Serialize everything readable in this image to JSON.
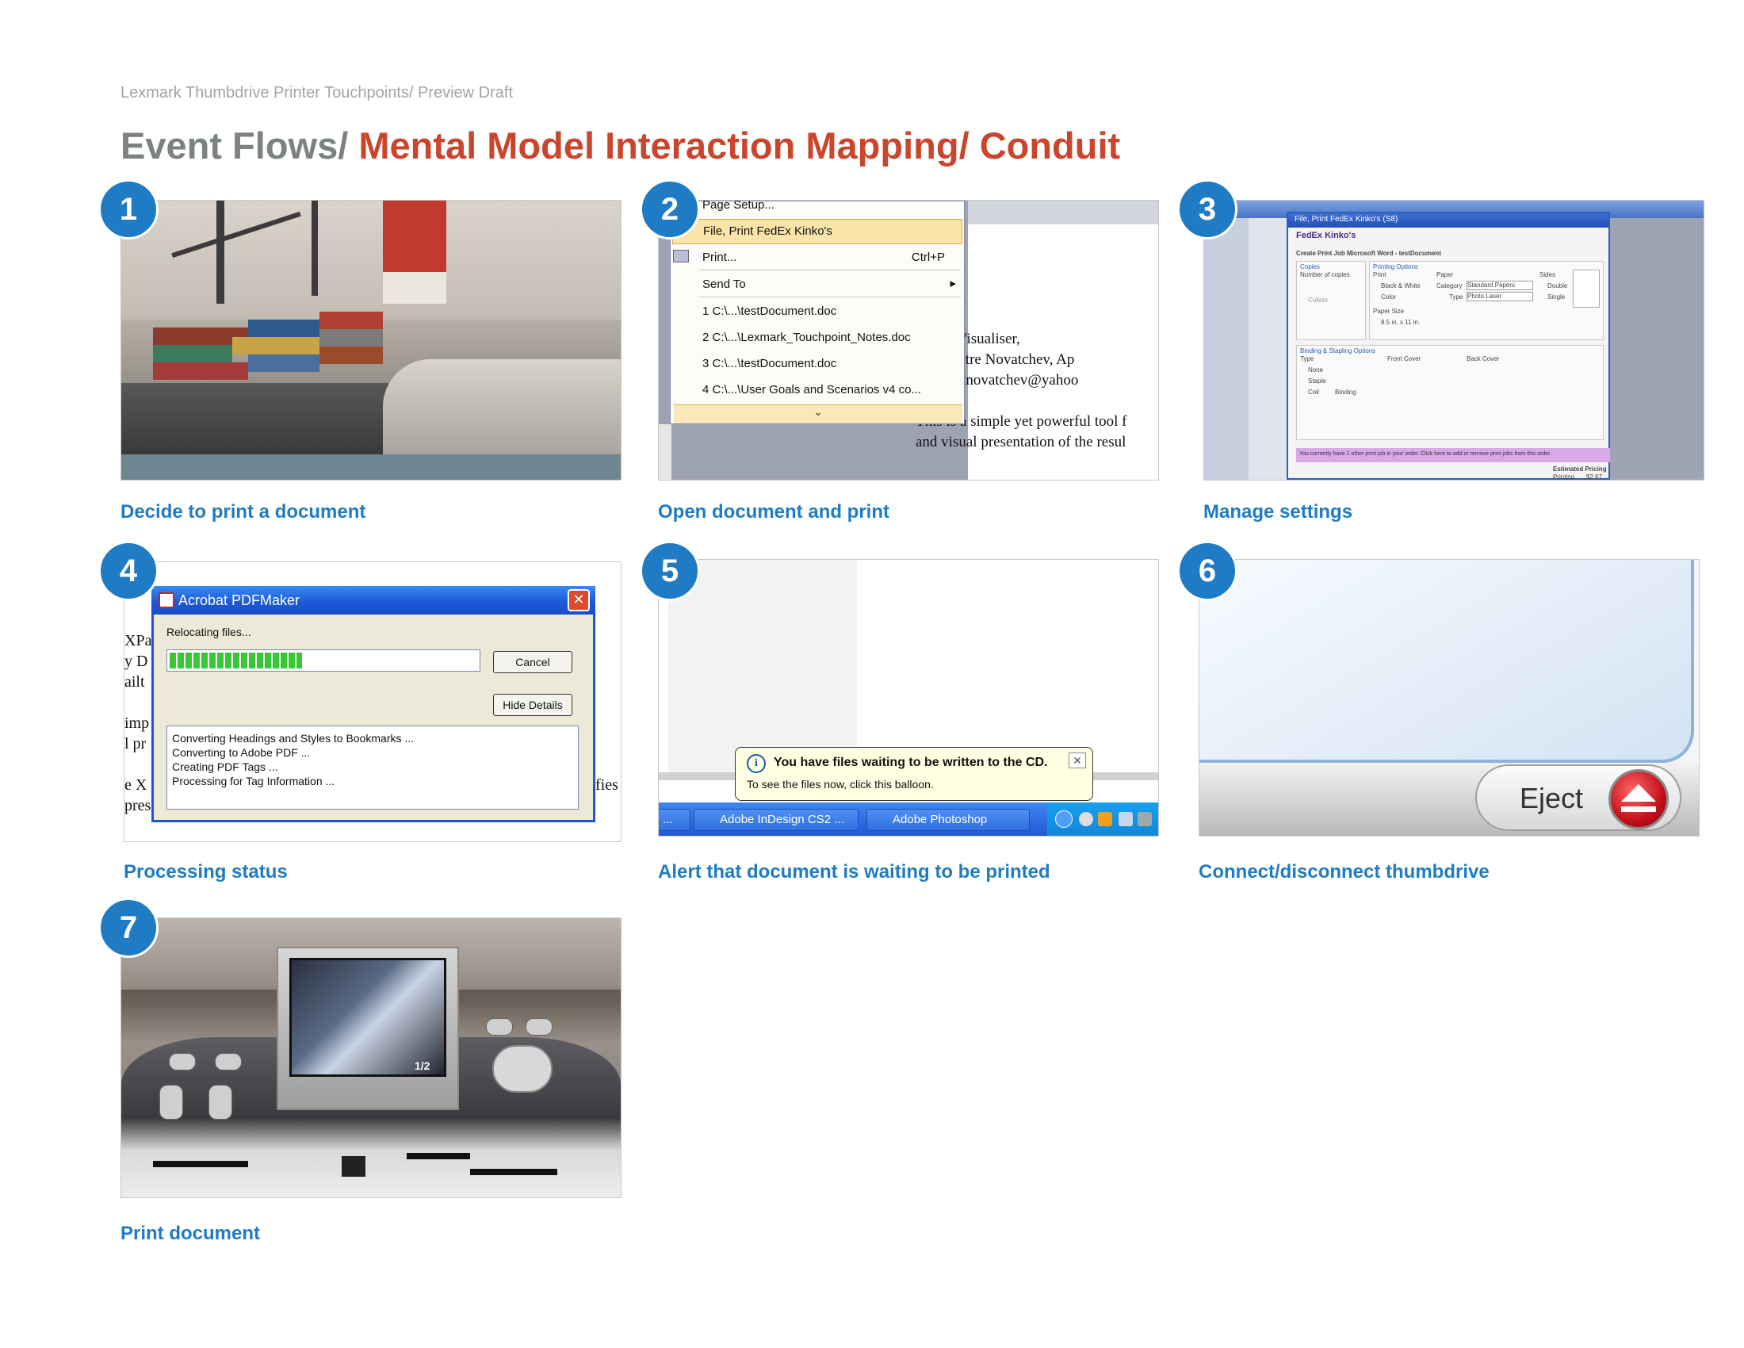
{
  "header": {
    "subtitle": "Lexmark Thumbdrive Printer Touchpoints/ Preview Draft",
    "title_prefix": "Event Flows/ ",
    "title_highlight": "Mental Model Interaction Mapping/ Conduit"
  },
  "colors": {
    "accent_blue": "#1f7bc4",
    "title_gray": "#7c8283",
    "title_red": "#c9462c"
  },
  "steps": [
    {
      "number": "1",
      "caption": "Decide to print a document"
    },
    {
      "number": "2",
      "caption": "Open document and print"
    },
    {
      "number": "3",
      "caption": "Manage settings"
    },
    {
      "number": "4",
      "caption": "Processing status"
    },
    {
      "number": "5",
      "caption": "Alert that document is waiting to be printed"
    },
    {
      "number": "6",
      "caption": "Connect/disconnect thumbdrive"
    },
    {
      "number": "7",
      "caption": "Print document"
    }
  ],
  "word_menu": {
    "page_setup": "Page Setup...",
    "print_fedex": "File, Print FedEx Kinko's",
    "print": "Print...",
    "print_shortcut": "Ctrl+P",
    "send_to": "Send To",
    "send_to_arrow": "▸",
    "recent_1": "1 C:\\...\\testDocument.doc",
    "recent_2": "2 C:\\...\\Lexmark_Touchpoint_Notes.doc",
    "recent_3": "3 C:\\...\\testDocument.doc",
    "recent_4": "4 C:\\...\\User Goals and Scenarios v4 co...",
    "more_icon": "double-chevron-down-icon",
    "more_glyph": "⌄",
    "doc_line_1": "XPath Visualiser,",
    "doc_line_2": "by Dimitre Novatchev, Ap",
    "doc_line_3": "mailto:dnovatchev@yahoo",
    "doc_line_4": "This is a simple yet powerful tool f",
    "doc_line_5": "and visual presentation of the resul"
  },
  "fedex_dialog": {
    "window_title": "File, Print FedEx Kinko's (S8)",
    "brand": "FedEx Kinko's",
    "heading": "Create Print Job Microsoft Word - testDocument",
    "copies": "Copies",
    "number_of_copies": "Number of copies",
    "collate": "Collate",
    "printing_options": "Printing Options",
    "print": "Print",
    "black_white": "Black & White",
    "color": "Color",
    "paper": "Paper",
    "category": "Category",
    "category_value": "Standard Papers",
    "type": "Type",
    "type_value": "Photo Laser",
    "sides": "Sides",
    "double": "Double",
    "single": "Single",
    "paper_size": "Paper Size",
    "paper_size_value": "8.5 in. x 11 in.",
    "binding": "Binding & Stapling Options",
    "binding_type": "Type",
    "none": "None",
    "staple": "Staple",
    "coil": "Coil",
    "binding_label": "Binding",
    "front_cover": "Front Cover",
    "back_cover": "Back Cover",
    "notice": "You currently have 1 other print job in your order. Click here to add or remove print jobs from this order.",
    "estimated_pricing": "Estimated Pricing",
    "printing": "Printing",
    "printing_price": "$2.67"
  },
  "pdfmaker": {
    "title": "Acrobat PDFMaker",
    "close_glyph": "✕",
    "status": "Relocating files...",
    "progress": 0.43,
    "cancel": "Cancel",
    "hide_details": "Hide Details",
    "log": [
      "Converting Headings and Styles to Bookmarks ...",
      "Converting to Adobe PDF ...",
      "Creating PDF Tags ...",
      "Processing for Tag Information ..."
    ],
    "bg_line_1": "XPat",
    "bg_line_2": "y D",
    "bg_line_3": "ailt",
    "bg_line_4": "imp",
    "bg_line_5": "l pr",
    "bg_line_6": "e X",
    "bg_line_7": "pres",
    "bg_line_8": "fies"
  },
  "balloon": {
    "info_glyph": "i",
    "title": "You have files waiting to be written to the CD.",
    "text": "To see the files now, click this balloon.",
    "close_glyph": "✕",
    "task_1": "...",
    "task_2": "Adobe InDesign CS2 ...",
    "task_3": "Adobe Photoshop"
  },
  "eject": {
    "label": "Eject"
  },
  "printer": {
    "lcd_counter": "1/2"
  }
}
